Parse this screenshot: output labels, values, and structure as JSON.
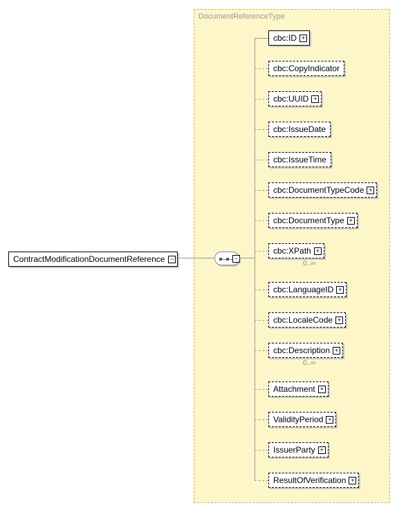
{
  "root": {
    "name": "ContractModificationDocumentReference"
  },
  "type": {
    "name": "DocumentReferenceType"
  },
  "children": [
    {
      "name": "cbc:ID",
      "required": true,
      "exp": true
    },
    {
      "name": "cbc:CopyIndicator",
      "required": false,
      "exp": false
    },
    {
      "name": "cbc:UUID",
      "required": false,
      "exp": true
    },
    {
      "name": "cbc:IssueDate",
      "required": false,
      "exp": false
    },
    {
      "name": "cbc:IssueTime",
      "required": false,
      "exp": false
    },
    {
      "name": "cbc:DocumentTypeCode",
      "required": false,
      "exp": true
    },
    {
      "name": "cbc:DocumentType",
      "required": false,
      "exp": true
    },
    {
      "name": "cbc:XPath",
      "required": false,
      "exp": true,
      "mult": "0..∞"
    },
    {
      "name": "cbc:LanguageID",
      "required": false,
      "exp": true
    },
    {
      "name": "cbc:LocaleCode",
      "required": false,
      "exp": true
    },
    {
      "name": "cbc:Description",
      "required": false,
      "exp": true,
      "mult": "0..∞"
    },
    {
      "name": "Attachment",
      "required": false,
      "exp": true
    },
    {
      "name": "ValidityPeriod",
      "required": false,
      "exp": true
    },
    {
      "name": "IssuerParty",
      "required": false,
      "exp": true
    },
    {
      "name": "ResultOfVerification",
      "required": false,
      "exp": true
    }
  ],
  "icons": {
    "plus": "+",
    "minus": "−"
  },
  "chart_data": {
    "type": "diagram",
    "title": "",
    "root": "ContractModificationDocumentReference",
    "complexType": "DocumentReferenceType",
    "compositor": "sequence",
    "elements": [
      {
        "name": "cbc:ID",
        "minOccurs": 1,
        "maxOccurs": 1
      },
      {
        "name": "cbc:CopyIndicator",
        "minOccurs": 0,
        "maxOccurs": 1
      },
      {
        "name": "cbc:UUID",
        "minOccurs": 0,
        "maxOccurs": 1
      },
      {
        "name": "cbc:IssueDate",
        "minOccurs": 0,
        "maxOccurs": 1
      },
      {
        "name": "cbc:IssueTime",
        "minOccurs": 0,
        "maxOccurs": 1
      },
      {
        "name": "cbc:DocumentTypeCode",
        "minOccurs": 0,
        "maxOccurs": 1
      },
      {
        "name": "cbc:DocumentType",
        "minOccurs": 0,
        "maxOccurs": 1
      },
      {
        "name": "cbc:XPath",
        "minOccurs": 0,
        "maxOccurs": "unbounded"
      },
      {
        "name": "cbc:LanguageID",
        "minOccurs": 0,
        "maxOccurs": 1
      },
      {
        "name": "cbc:LocaleCode",
        "minOccurs": 0,
        "maxOccurs": 1
      },
      {
        "name": "cbc:Description",
        "minOccurs": 0,
        "maxOccurs": "unbounded"
      },
      {
        "name": "Attachment",
        "minOccurs": 0,
        "maxOccurs": 1
      },
      {
        "name": "ValidityPeriod",
        "minOccurs": 0,
        "maxOccurs": 1
      },
      {
        "name": "IssuerParty",
        "minOccurs": 0,
        "maxOccurs": 1
      },
      {
        "name": "ResultOfVerification",
        "minOccurs": 0,
        "maxOccurs": 1
      }
    ]
  }
}
